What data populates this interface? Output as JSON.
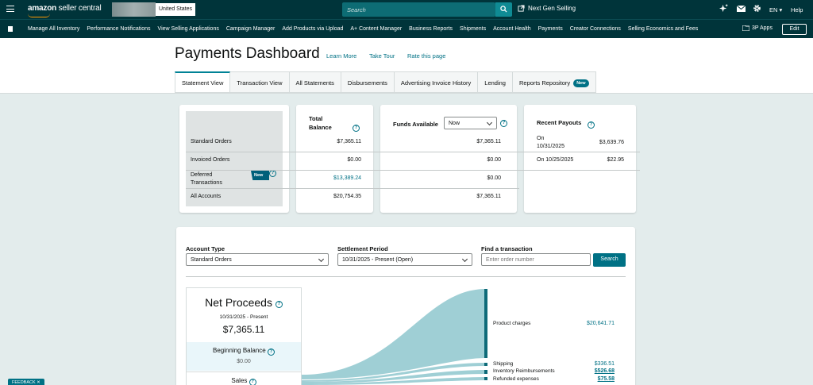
{
  "topbar": {
    "logo_bold": "amazon",
    "logo_rest": " seller central",
    "country": "United States",
    "search_placeholder": "Search",
    "next_gen": "Next Gen Selling",
    "lang": "EN",
    "help": "Help"
  },
  "nav": {
    "links": [
      "Manage All Inventory",
      "Performance Notifications",
      "View Selling Applications",
      "Campaign Manager",
      "Add Products via Upload",
      "A+ Content Manager",
      "Business Reports",
      "Shipments",
      "Account Health",
      "Payments",
      "Creator Connections",
      "Selling Economics and Fees"
    ],
    "apps": "3P Apps",
    "edit": "Edit"
  },
  "header": {
    "title": "Payments Dashboard",
    "learn_more": "Learn More",
    "take_tour": "Take Tour",
    "rate_page": "Rate this page"
  },
  "tabs": [
    "Statement View",
    "Transaction View",
    "All Statements",
    "Disbursements",
    "Advertising Invoice History",
    "Lending",
    "Reports Repository"
  ],
  "tab_new_badge": "New",
  "summary": {
    "rows": [
      "Standard Orders",
      "Invoiced Orders",
      "Deferred Transactions",
      "All Accounts"
    ],
    "deferred_badge": "New",
    "total_balance_header": "Total Balance",
    "total_balance": [
      "$7,365.11",
      "$0.00",
      "$13,389.24",
      "$20,754.35"
    ],
    "funds_header": "Funds Available",
    "funds_select": "Now",
    "funds": [
      "$7,365.11",
      "$0.00",
      "$0.00",
      "$7,365.11"
    ],
    "payouts_header": "Recent Payouts",
    "payouts": [
      {
        "date": "On 10/31/2025",
        "amount": "$3,639.76"
      },
      {
        "date": "On 10/25/2025",
        "amount": "$22.95"
      }
    ]
  },
  "filters": {
    "account_type_label": "Account Type",
    "account_type_value": "Standard Orders",
    "settlement_label": "Settlement Period",
    "settlement_value": "10/31/2025 - Present (Open)",
    "find_label": "Find a transaction",
    "find_placeholder": "Enter order number",
    "search_button": "Search"
  },
  "proceeds": {
    "title": "Net Proceeds",
    "period": "10/31/2025 - Present",
    "amount": "$7,365.11",
    "beginning_label": "Beginning Balance",
    "beginning_value": "$0.00",
    "sales_label": "Sales"
  },
  "flows": [
    {
      "label": "Product charges",
      "value": "$20,641.71"
    },
    {
      "label": "Shipping",
      "value": "$336.51"
    },
    {
      "label": "Inventory Reimbursements",
      "value": "$526.68"
    },
    {
      "label": "Refunded expenses",
      "value": "$75.58"
    }
  ],
  "feedback": "FEEDBACK"
}
